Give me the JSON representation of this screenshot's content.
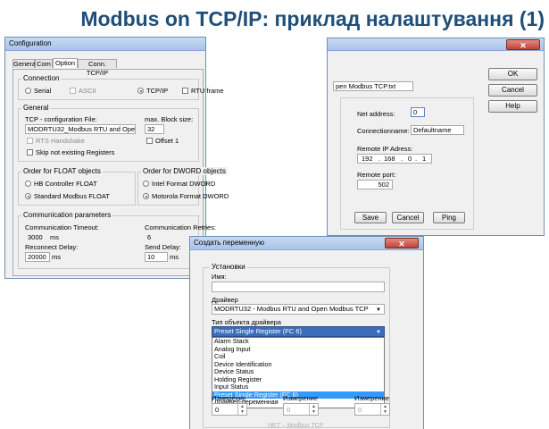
{
  "slide_title": "Modbus on TCP/IP: приклад налаштування (1)",
  "config": {
    "title": "Configuration",
    "tabs": [
      "General",
      "Com",
      "Option",
      "Conn. TCP/IP"
    ],
    "connection": {
      "label": "Connection",
      "serial": "Serial",
      "ascii": "ASCII",
      "tcpip": "TCP/IP",
      "rtu_frame": "RTU frame"
    },
    "general": {
      "label": "General",
      "tcp_file_label": "TCP - configuration File:",
      "tcp_file_value": "MODRTU32_Modbus RTU and Open Moc",
      "block_label": "max. Block size:",
      "block_value": "32",
      "rts": "RTS Handshake",
      "offset": "Offset 1",
      "skip": "Skip not existing Registers"
    },
    "float": {
      "label": "Order for FLOAT objects",
      "hb": "HB Controller FLOAT",
      "standard": "Standard Modbus FLOAT"
    },
    "dword": {
      "label": "Order for DWORD objects",
      "intel": "Intel Format DWORD",
      "motorola": "Motorola Format DWORD"
    },
    "comm": {
      "label": "Communication parameters",
      "timeout_label": "Communication Timeout:",
      "timeout_value": "3000",
      "timeout_unit": "ms",
      "retries_label": "Communication Retries:",
      "retries_value": "6",
      "reconnect_label": "Reconnect Delay:",
      "reconnect_value": "20000",
      "reconnect_unit": "ms",
      "send_label": "Send Delay:",
      "send_value": "10",
      "send_unit": "ms"
    }
  },
  "tcp": {
    "file_field": "pen Modbus TCP.txt",
    "ok": "OK",
    "cancel": "Cancel",
    "help": "Help",
    "net_label": "Net address:",
    "net_value": "0",
    "connname_label": "Connectionname:",
    "connname_value": "Defaultname",
    "remote_ip_label": "Remote IP Adress:",
    "ip": [
      "192",
      "168",
      "0",
      "1"
    ],
    "port_label": "Remote port:",
    "port_value": "502",
    "save": "Save",
    "cancel2": "Cancel",
    "ping": "Ping"
  },
  "create_var": {
    "title": "Создать переменную",
    "settings_label": "Установки",
    "name_label": "Имя:",
    "name_value": "",
    "driver_label": "Драйвер",
    "driver_value": "MODRTU32 - Modbus RTU and Open Modbus TCP",
    "type_label": "Тип объекта драйвера",
    "type_value": "Preset Single Register (FC 6)",
    "options": [
      "Alarm Stack",
      "Analog Input",
      "Coil",
      "Device Identification",
      "Device Status",
      "Holding Register",
      "Input Status",
      "Preset Single Register (FC 6)",
      "Драйвер-переменная"
    ],
    "selected_index": 7,
    "dim1_label": "Измерение",
    "dim2_label": "Измерение",
    "dim3_label": "Измерение",
    "dim1_value": "0",
    "dim2_value": "0",
    "dim3_value": "0"
  },
  "footer_text": "NET – Modbus TCP"
}
